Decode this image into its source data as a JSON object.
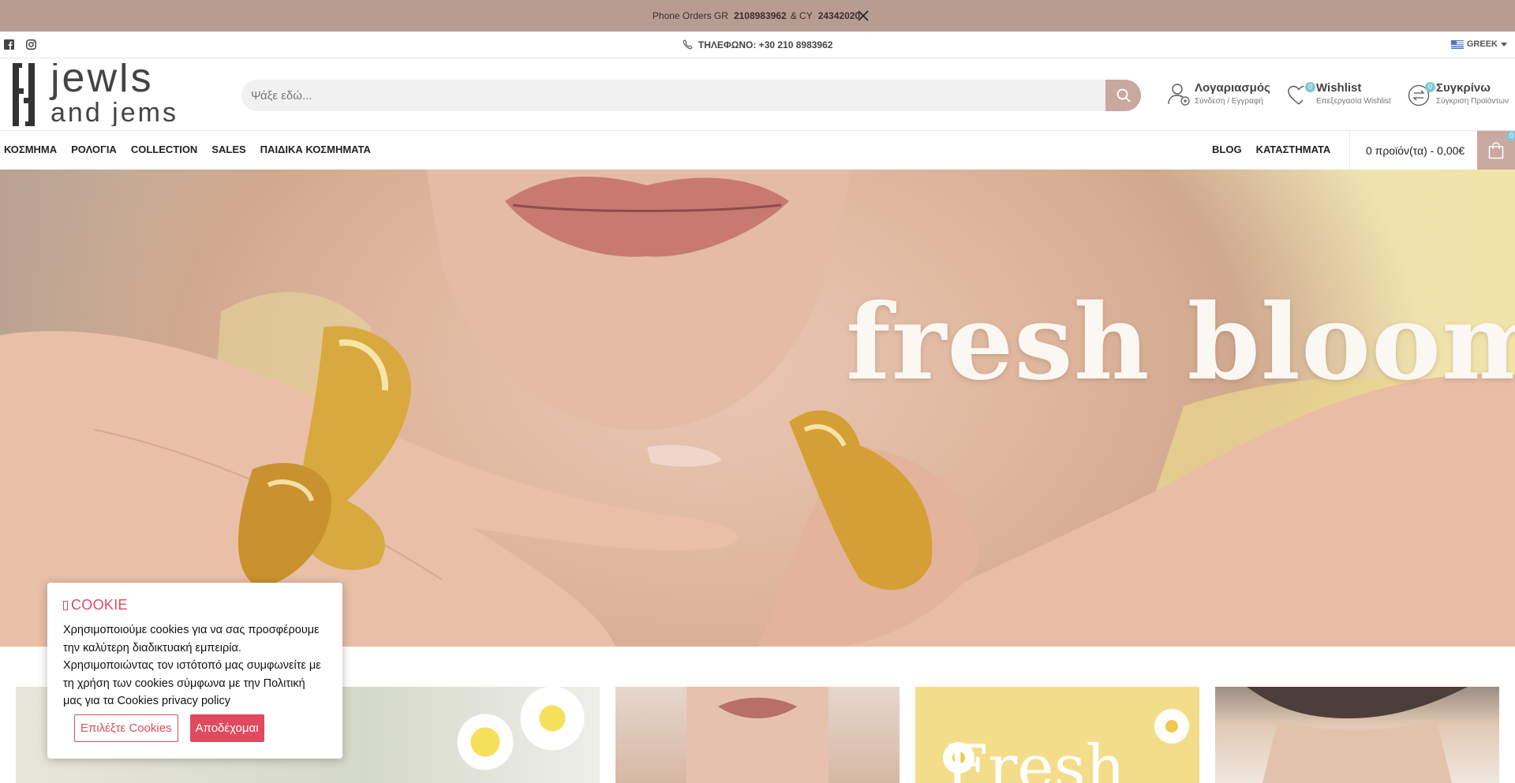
{
  "promo": {
    "prefix": "Phone Orders GR",
    "gr_number": "2108983962",
    "mid": "& CY",
    "cy_number": "24342020",
    "close_icon": "close-icon"
  },
  "utility": {
    "social_icons": [
      "facebook-icon",
      "instagram-icon"
    ],
    "phone_label": "ΤΗΛΕΦΩΝΟ: +30 210 8983962",
    "language": "GREEK"
  },
  "header": {
    "logo_line1": "jewls",
    "logo_line2": "and jems",
    "search_placeholder": "Ψάξε εδώ...",
    "account": {
      "title": "Λογαριασμός",
      "subtitle": "Σύνδεση / Εγγραφή"
    },
    "wishlist": {
      "title": "Wishlist",
      "subtitle": "Επεξεργασία Wishlist",
      "count": "0"
    },
    "compare": {
      "title": "Συγκρίνω",
      "subtitle": "Σύγκριση Προϊόντων",
      "count": "0"
    }
  },
  "nav": {
    "left": [
      "ΚΟΣΜΗΜΑ",
      "ΡΟΛΟΓΙΑ",
      "COLLECTION",
      "SALES",
      "ΠΑΙΔΙΚΑ ΚΟΣΜΗΜΑΤΑ"
    ],
    "right": [
      "BLOG",
      "ΚΑΤΑΣΤΗΜΑΤΑ"
    ],
    "cart_text": "0 προϊόν(τα) - 0,00€",
    "cart_count": "0"
  },
  "hero": {
    "title": "fresh blooms"
  },
  "tiles": {
    "t3_word": "Fresh"
  },
  "cookie": {
    "title": "COOKIE",
    "text": "Χρησιμοποιούμε cookies για να σας προσφέρουμε την καλύτερη διαδικτυακή εμπειρία. Χρησιμοποιώντας τον ιστότοπό μας συμφωνείτε με τη χρήση των cookies σύμφωνα με την Πολιτική μας για τα Cookies privacy policy",
    "choose_label": "Επιλέξτε Cookies",
    "accept_label": "Αποδέχομαι"
  },
  "colors": {
    "promo_bg": "#b89c92",
    "accent": "#c9a89f",
    "cookie_accent": "#e04a5c",
    "badge": "#7fc8d4"
  }
}
